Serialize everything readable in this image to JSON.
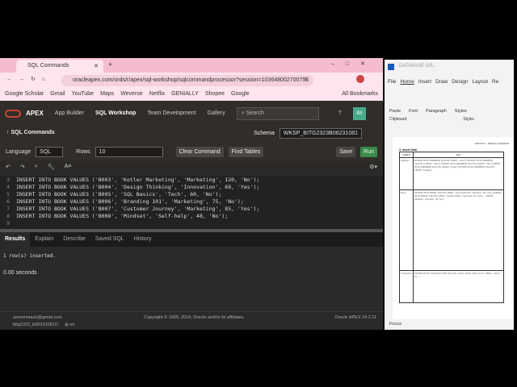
{
  "browser": {
    "tab_title": "SQL Commands",
    "url": "oracleapex.com/ords/r/apex/sql-workshop/sqlcommandprocessor?session=103648002700756",
    "bookmarks": [
      "Google Scholar",
      "Gmail",
      "YouTube",
      "Maps",
      "Weverse",
      "Netflix",
      "GENIALLY",
      "Shopee",
      "Google"
    ],
    "all_bookmarks": "All Bookmarks"
  },
  "apex": {
    "brand": "APEX",
    "nav": [
      "App Builder",
      "SQL Workshop",
      "Team Development",
      "Gallery"
    ],
    "search_placeholder": "Search",
    "avatar": "IM",
    "page_title": "SQL Commands",
    "schema_label": "Schema",
    "schema_value": "WKSP_BITG2323B06231081",
    "language_label": "Language",
    "language_value": "SQL",
    "rows_label": "Rows",
    "rows_value": "10",
    "clear_command": "Clear Command",
    "find_tables": "Find Tables",
    "save": "Save",
    "run": "Run",
    "code_lines": [
      {
        "n": "3",
        "t": "INSERT INTO BOOK VALUES ('B003', 'Kotler Marketing', 'Marketing', 120, 'No');"
      },
      {
        "n": "4",
        "t": "INSERT INTO BOOK VALUES ('B004', 'Design Thinking', 'Innovation', 68, 'Yes');"
      },
      {
        "n": "5",
        "t": "INSERT INTO BOOK VALUES ('B005', 'SQL Basics', 'Tech', 60, 'No');"
      },
      {
        "n": "6",
        "t": "INSERT INTO BOOK VALUES ('B006', 'Branding 101', 'Marketing', 75, 'No');"
      },
      {
        "n": "7",
        "t": "INSERT INTO BOOK VALUES ('B007', 'Customer Journey', 'Marketing', 85, 'Yes');"
      },
      {
        "n": "8",
        "t": "INSERT INTO BOOK VALUES ('B008', 'Mindset', 'Self-help', 48, 'No');"
      },
      {
        "n": "9",
        "t": ""
      }
    ],
    "result_tabs": [
      "Results",
      "Explain",
      "Describe",
      "Saved SQL",
      "History"
    ],
    "result_message": "1 row(s) inserted.",
    "elapsed": "0.00 seconds",
    "footer": {
      "email": "azreenmazri@gmail.com",
      "workspace": "bitg2323_b06231081O",
      "lang": "en",
      "copyright": "Copyright © 1999, 2024, Oracle and/or its affiliates.",
      "version": "Oracle APEX 24.2.11"
    }
  },
  "word": {
    "title": "DATABASE GR...",
    "tabs": [
      "File",
      "Home",
      "Insert",
      "Draw",
      "Design",
      "Layout",
      "Re"
    ],
    "ribbon": [
      "Paste",
      "Font",
      "Paragraph",
      "Styles"
    ],
    "groups": [
      "Clipboard",
      "Styles"
    ],
    "header_text": "GROUP 1 - IRDINA & KERSAN",
    "section": "3. Insert Data",
    "col_table": "TABLE",
    "col_sql": "SQL",
    "rows": [
      {
        "table": "Member",
        "sql": "INSERT INTO MEMBER VALUES ('M001', 'Aina'); INSERT INTO MEMBER VALUES ('M002', 'Amir'); INSERT INTO MEMBER VALUES ('M003', 'Siti'); INSERT INTO MEMBER VALUES ('M004', 'Farah'); INSERT INTO MEMBER VALUES ('M005', 'Daniel');"
      },
      {
        "table": "Book",
        "sql": "INSERT INTO BOOK VALUES ('B001', 'Start With Why', 'Business', 80, 'Yes'); INSERT INTO BOOK VALUES ('B002', 'Atomic Habits', 'Self-help', 95, 'Yes'); ... ('B008', 'Mindset', 'Self-help', 48, 'No');"
      },
      {
        "table": "Transaction",
        "sql": "INSERT INTO TRANSACTION VALUES ('T001', DATE '2025-01-07', 'M001', 'Silver', 0); ..."
      }
    ],
    "focus": "Focus"
  }
}
